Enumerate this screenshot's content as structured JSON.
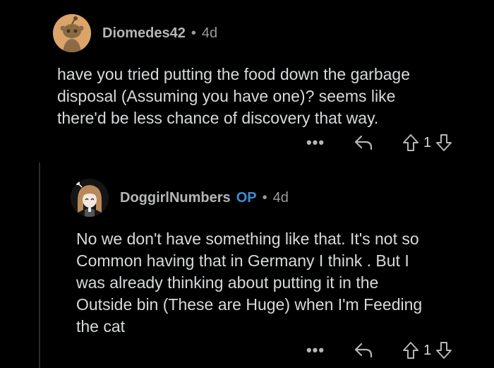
{
  "comments": [
    {
      "username": "Diomedes42",
      "op": "",
      "age": "4d",
      "body": "have you tried putting the food down the garbage\ndisposal (Assuming you have one)? seems like\nthere'd be less chance of discovery that way.",
      "votes": "1",
      "more_label": "•••",
      "avatar_icon": "reddit-snoo-avatar",
      "separator": "•"
    },
    {
      "username": "DoggirlNumbers",
      "op": "OP",
      "age": "4d",
      "body": "No we don't have something like that. It's not so\nCommon having that in Germany I think . But I\nwas already thinking about putting it in the\nOutside bin (These are Huge) when I'm Feeding\nthe cat",
      "votes": "1",
      "more_label": "•••",
      "avatar_icon": "anime-girl-avatar",
      "separator": "•"
    }
  ],
  "colors": {
    "background": "#000000",
    "text": "#d7dadc",
    "username": "#b4b6b8",
    "op_badge": "#3f8bd6",
    "icon": "#b4b6b8"
  }
}
